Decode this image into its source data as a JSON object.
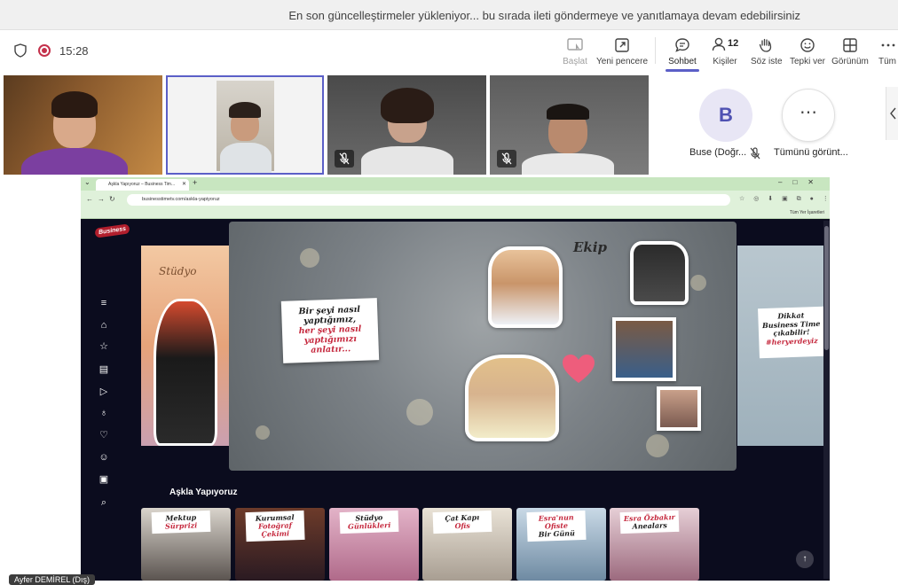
{
  "banner": {
    "message": "En son güncelleştirmeler yükleniyor... bu sırada ileti göndermeye ve yanıtlamaya devam edebilirsiniz"
  },
  "toolbar": {
    "timer": "15:28",
    "start_label": "Başlat",
    "new_window_label": "Yeni pencere",
    "chat_label": "Sohbet",
    "people_label": "Kişiler",
    "people_count": "12",
    "raise_hand_label": "Söz iste",
    "react_label": "Tepki ver",
    "view_label": "Görünüm",
    "more_label": "Tüm"
  },
  "participants": {
    "avatar_initial": "B",
    "avatar_name": "Buse (Doğr...",
    "see_all_label": "Tümünü görünt...",
    "more_glyph": "⋯"
  },
  "browser": {
    "tab_title": "Aşkla Yapıyoruz – Business Tim...",
    "url": "businesstimetv.com/askla-yapiyoruz",
    "bookmarks_label": "Tüm Yer İşaretleri"
  },
  "site": {
    "logo": "Business",
    "left_slide_title": "Stüdyo",
    "note_line1": "Bir şeyi nasıl",
    "note_line2": "yaptığımız,",
    "note_line3": "her şeyi nasıl",
    "note_line4": "yaptığımızı",
    "note_line5": "anlatır...",
    "ekip_label": "Ekip",
    "right_note_line1": "Dikkat",
    "right_note_line2": "Business Time",
    "right_note_line3": "çıkabilir!",
    "right_note_line4": "#heryerdeyiz",
    "section_title": "Aşkla Yapıyoruz",
    "cards": [
      {
        "line1": "Mektup",
        "line2": "Sürprizi"
      },
      {
        "line1": "Kurumsal",
        "line2": "Fotoğraf",
        "line3": "Çekimi"
      },
      {
        "line1": "Stüdyo",
        "line2": "Günlükleri"
      },
      {
        "line1": "Çat Kapı",
        "line2": "Ofis"
      },
      {
        "line1": "Esra'nun Ofiste",
        "line2": "Bir Günü"
      },
      {
        "line1": "Esra Özbakır",
        "line2": "Anealars"
      }
    ]
  },
  "presenter": {
    "name_tag": "Ayfer DEMİREL (Dış)"
  },
  "colors": {
    "accent": "#5b5fc7",
    "record": "#c4314b",
    "site_bg": "#0b0c1e",
    "browser_chrome": "#dff1da"
  }
}
